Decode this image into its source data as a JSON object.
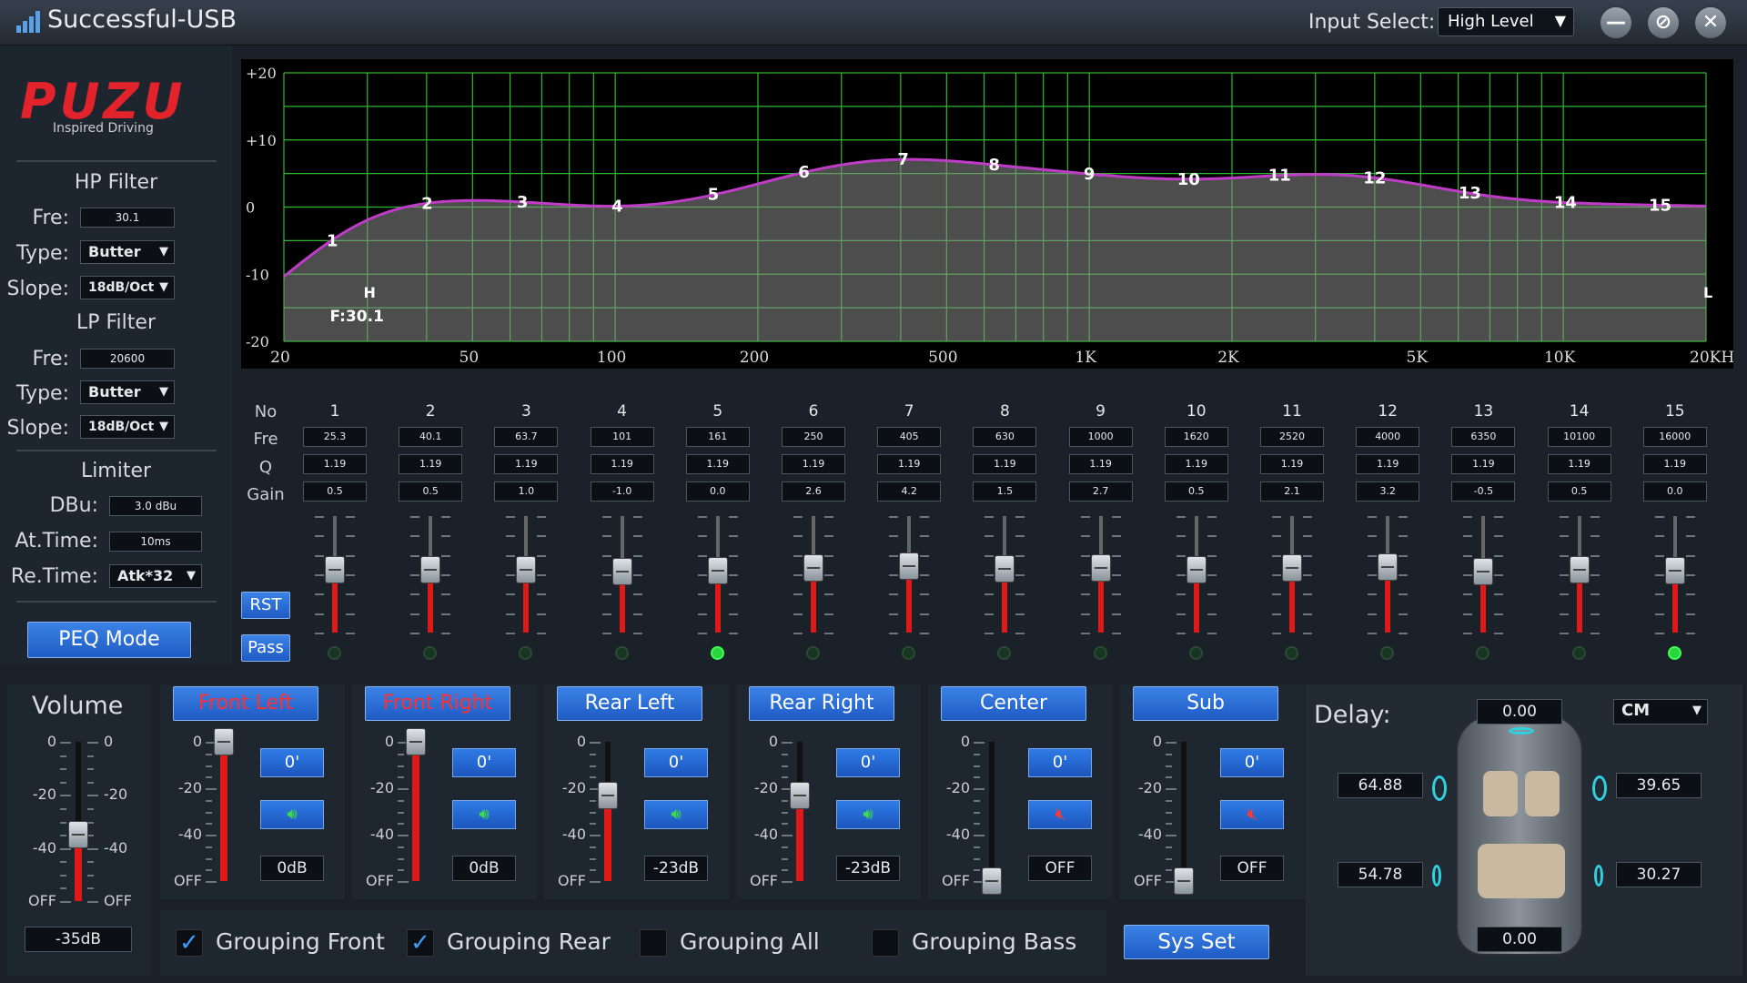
{
  "titlebar": {
    "title": "Successful-USB",
    "input_label": "Input Select:",
    "input_value": "High Level",
    "minimize": "—",
    "restore": "⊘",
    "close": "✕"
  },
  "brand": {
    "logo": "PUZU",
    "tagline": "Inspired Driving"
  },
  "hp_filter": {
    "title": "HP Filter",
    "fre_label": "Fre:",
    "fre": "30.1",
    "type_label": "Type:",
    "type": "Butter",
    "slope_label": "Slope:",
    "slope": "18dB/Oct"
  },
  "lp_filter": {
    "title": "LP Filter",
    "fre_label": "Fre:",
    "fre": "20600",
    "type_label": "Type:",
    "type": "Butter",
    "slope_label": "Slope:",
    "slope": "18dB/Oct"
  },
  "limiter": {
    "title": "Limiter",
    "dbu_label": "DBu:",
    "dbu": "3.0 dBu",
    "at_label": "At.Time:",
    "at": "10ms",
    "re_label": "Re.Time:",
    "re": "Atk*32"
  },
  "peq_mode": "PEQ Mode",
  "graph": {
    "y_labels": [
      "+20",
      "+10",
      "0",
      "-10",
      "-20"
    ],
    "x_labels": [
      "20",
      "50",
      "100",
      "200",
      "500",
      "1K",
      "2K",
      "5K",
      "10K",
      "20KHz"
    ],
    "hp_marker": "H",
    "lp_marker": "L",
    "hp_freq_label": "F:30.1",
    "curve_color": "#c03cc8",
    "grid_color": "#2fb82f"
  },
  "peq": {
    "row_labels": {
      "no": "No",
      "fre": "Fre",
      "q": "Q",
      "gain": "Gain"
    },
    "bands": [
      {
        "no": "1",
        "fre": "25.3",
        "q": "1.19",
        "gain": "0.5",
        "active": false
      },
      {
        "no": "2",
        "fre": "40.1",
        "q": "1.19",
        "gain": "0.5",
        "active": false
      },
      {
        "no": "3",
        "fre": "63.7",
        "q": "1.19",
        "gain": "1.0",
        "active": false
      },
      {
        "no": "4",
        "fre": "101",
        "q": "1.19",
        "gain": "-1.0",
        "active": false
      },
      {
        "no": "5",
        "fre": "161",
        "q": "1.19",
        "gain": "0.0",
        "active": true
      },
      {
        "no": "6",
        "fre": "250",
        "q": "1.19",
        "gain": "2.6",
        "active": false
      },
      {
        "no": "7",
        "fre": "405",
        "q": "1.19",
        "gain": "4.2",
        "active": false
      },
      {
        "no": "8",
        "fre": "630",
        "q": "1.19",
        "gain": "1.5",
        "active": false
      },
      {
        "no": "9",
        "fre": "1000",
        "q": "1.19",
        "gain": "2.7",
        "active": false
      },
      {
        "no": "10",
        "fre": "1620",
        "q": "1.19",
        "gain": "0.5",
        "active": false
      },
      {
        "no": "11",
        "fre": "2520",
        "q": "1.19",
        "gain": "2.1",
        "active": false
      },
      {
        "no": "12",
        "fre": "4000",
        "q": "1.19",
        "gain": "3.2",
        "active": false
      },
      {
        "no": "13",
        "fre": "6350",
        "q": "1.19",
        "gain": "-0.5",
        "active": false
      },
      {
        "no": "14",
        "fre": "10100",
        "q": "1.19",
        "gain": "0.5",
        "active": false
      },
      {
        "no": "15",
        "fre": "16000",
        "q": "1.19",
        "gain": "0.0",
        "active": true
      }
    ],
    "rst": "RST",
    "pass": "Pass"
  },
  "volume": {
    "title": "Volume",
    "value": "-35dB",
    "scale": [
      "0",
      "-20",
      "-40",
      "OFF"
    ],
    "level_db": -35
  },
  "channels": [
    {
      "name": "Front Left",
      "phase": "0'",
      "value": "0dB",
      "muted": false,
      "selected": true,
      "level_db": 0
    },
    {
      "name": "Front Right",
      "phase": "0'",
      "value": "0dB",
      "muted": false,
      "selected": true,
      "level_db": 0
    },
    {
      "name": "Rear Left",
      "phase": "0'",
      "value": "-23dB",
      "muted": false,
      "selected": false,
      "level_db": -23
    },
    {
      "name": "Rear Right",
      "phase": "0'",
      "value": "-23dB",
      "muted": false,
      "selected": false,
      "level_db": -23
    },
    {
      "name": "Center",
      "phase": "0'",
      "value": "OFF",
      "muted": true,
      "selected": false,
      "level_db": -60
    },
    {
      "name": "Sub",
      "phase": "0'",
      "value": "OFF",
      "muted": true,
      "selected": false,
      "level_db": -60
    }
  ],
  "channel_scale": [
    "0",
    "-20",
    "-40",
    "OFF"
  ],
  "grouping": [
    {
      "label": "Grouping Front",
      "checked": true
    },
    {
      "label": "Grouping Rear",
      "checked": true
    },
    {
      "label": "Grouping All",
      "checked": false
    },
    {
      "label": "Grouping Bass",
      "checked": false
    }
  ],
  "sys_set": "Sys Set",
  "delay": {
    "title": "Delay:",
    "unit": "CM",
    "top": "0.00",
    "bottom": "0.00",
    "front_left": "64.88",
    "front_right": "39.65",
    "rear_left": "54.78",
    "rear_right": "30.27"
  }
}
